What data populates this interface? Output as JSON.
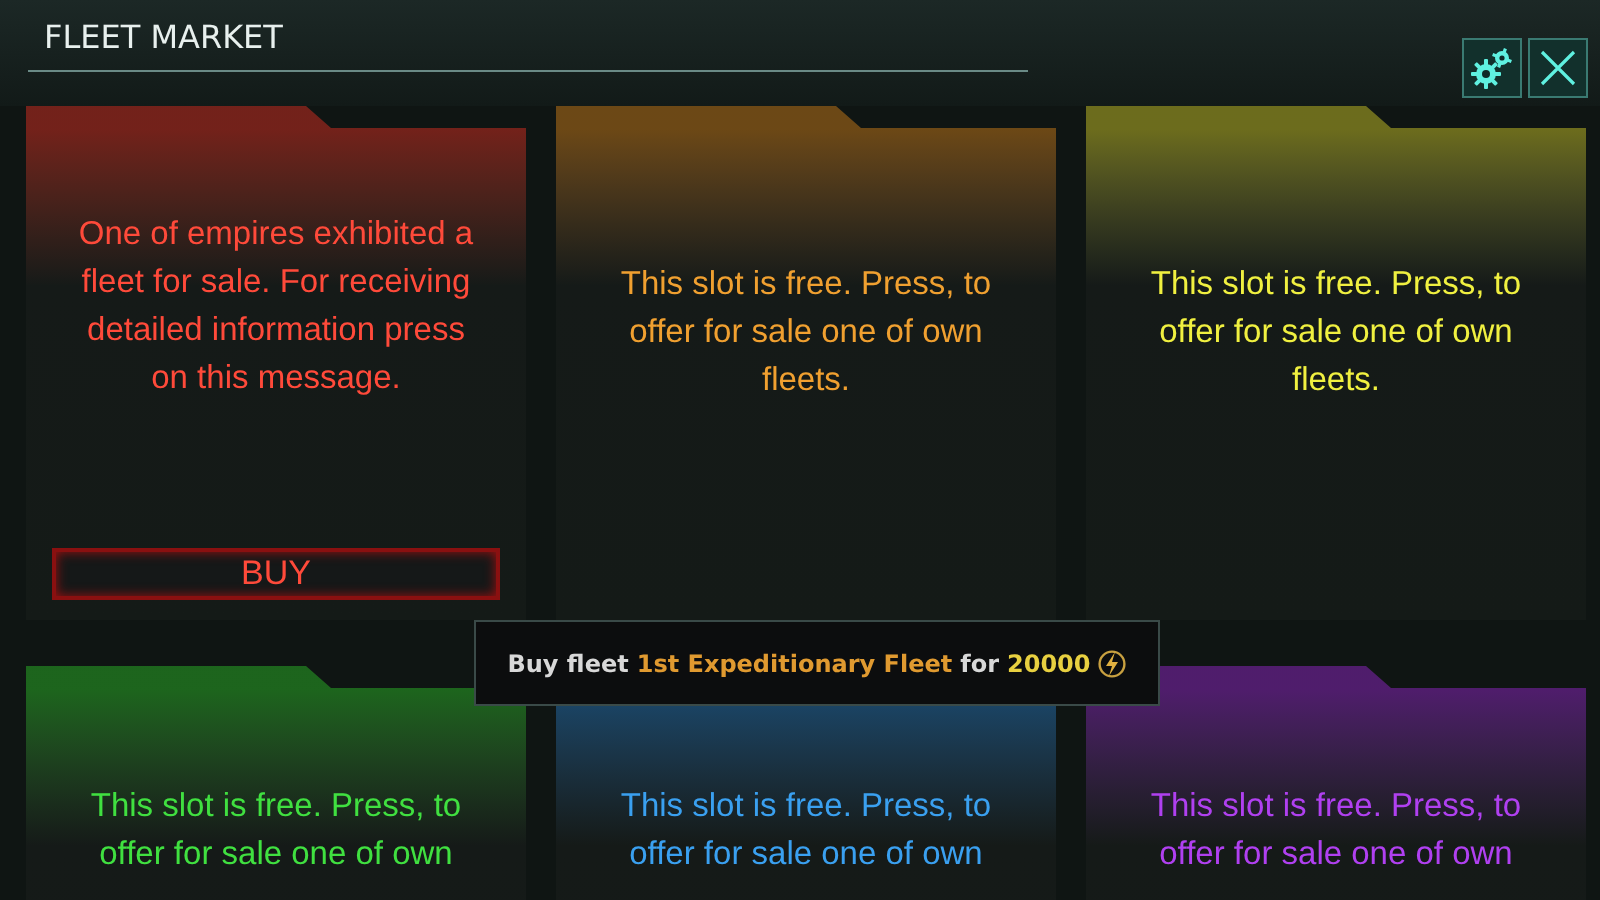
{
  "window": {
    "title": "FLEET MARKET",
    "buttons": [
      {
        "kind": "settings"
      },
      {
        "kind": "close"
      }
    ]
  },
  "slots": [
    {
      "kind": "offer",
      "color": "#ff4a3a",
      "text": "One of empires exhibited a fleet for sale. For receiving detailed information press on this message.",
      "button": "BUY"
    },
    {
      "kind": "free",
      "color": "#f0a030",
      "text": "This slot is free. Press, to offer for sale one of own fleets."
    },
    {
      "kind": "free",
      "color": "#f0f040",
      "text": "This slot is free. Press, to offer for sale one of own fleets."
    },
    {
      "kind": "free",
      "color": "#40e040",
      "text": "This slot is free. Press, to offer for sale one of own"
    },
    {
      "kind": "free",
      "color": "#3aa0f0",
      "text": "This slot is free. Press, to offer for sale one of own"
    },
    {
      "kind": "free",
      "color": "#b040f0",
      "text": "This slot is free. Press, to offer for sale one of own"
    }
  ],
  "tooltip": {
    "prefix": "Buy fleet",
    "fleet_name": "1st Expeditionary Fleet",
    "connector": "for",
    "price": "20000"
  }
}
